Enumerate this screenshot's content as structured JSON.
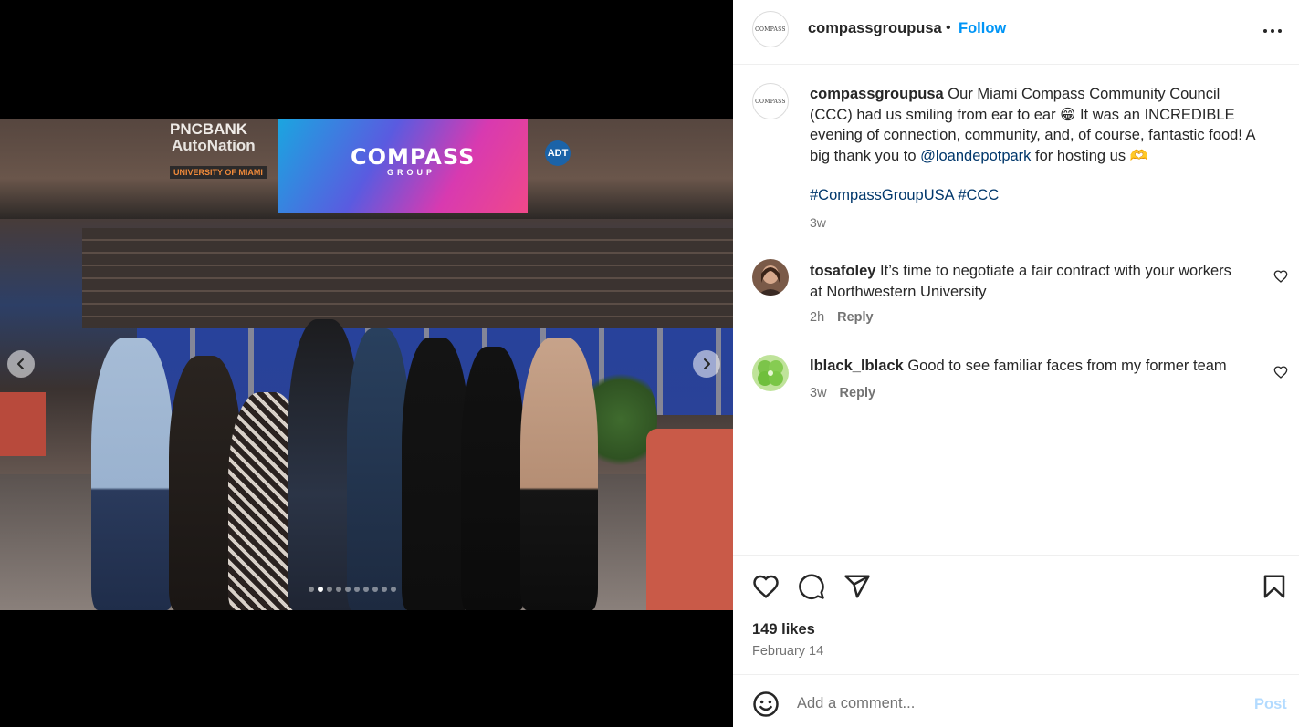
{
  "media": {
    "screen_title": "COMPASS",
    "screen_subtitle": "GROUP",
    "signs": [
      "PNCBANK",
      "AutoNation",
      "UNIVERSITY OF MIAMI",
      "ADT"
    ],
    "carousel": {
      "total_slides": 10,
      "active_index": 1
    },
    "prev_icon": "chevron-left-icon",
    "next_icon": "chevron-right-icon"
  },
  "header": {
    "username": "compassgroupusa",
    "separator": "•",
    "follow_label": "Follow",
    "avatar_logo_text": "COMPASS",
    "more_icon": "more-horizontal-icon"
  },
  "caption": {
    "username": "compassgroupusa",
    "text_1": " Our Miami Compass Community Council (CCC) had us smiling from ear to ear 😁 It was an INCREDIBLE evening of connection, community, and, of course, fantastic food! A big thank you to ",
    "mention": "@loandepotpark",
    "text_2": " for hosting us 🫶",
    "hashtag_1": "#CompassGroupUSA",
    "hashtag_2": "#CCC",
    "time": "3w"
  },
  "comments": [
    {
      "username": "tosafoley",
      "text": " It’s time to negotiate a fair contract with your workers at Northwestern University",
      "time": "2h",
      "reply_label": "Reply"
    },
    {
      "username": "lblack_lblack",
      "text": " Good to see familiar faces from my former team",
      "time": "3w",
      "reply_label": "Reply"
    }
  ],
  "actions": {
    "like_icon": "heart-icon",
    "comment_icon": "comment-icon",
    "share_icon": "send-icon",
    "save_icon": "bookmark-icon",
    "likes_text": "149 likes",
    "date": "February 14"
  },
  "comment_box": {
    "emoji_icon": "emoji-icon",
    "placeholder": "Add a comment...",
    "post_label": "Post"
  },
  "colors": {
    "link": "#0095f6",
    "mention": "#00376b",
    "muted": "#737373",
    "post_disabled": "#b3dbff"
  }
}
